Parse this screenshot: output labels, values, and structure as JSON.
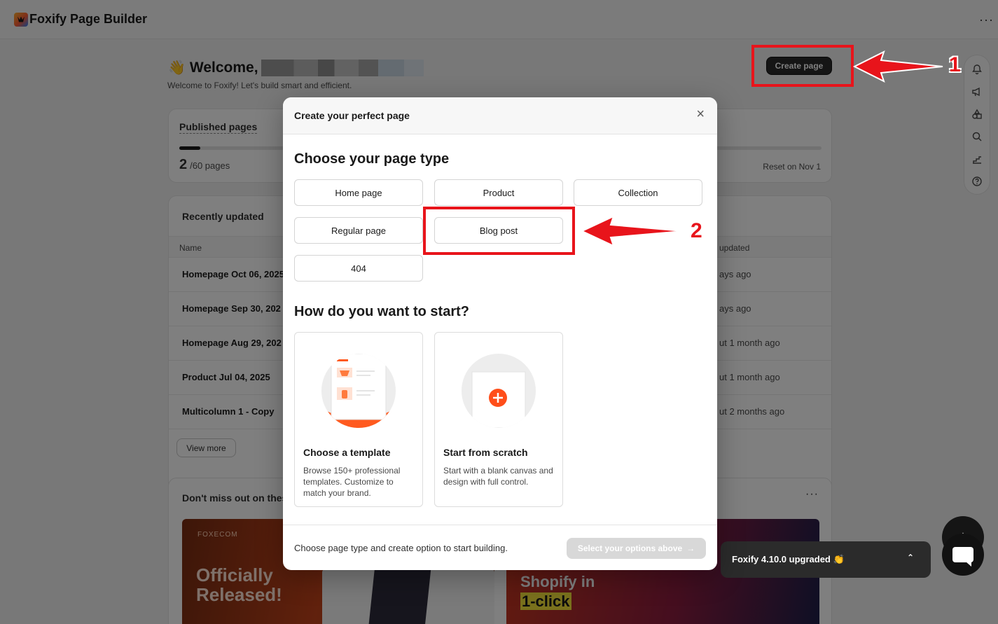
{
  "app": {
    "title": "Foxify Page Builder",
    "more_icon": "more-horizontal-icon"
  },
  "dashboard": {
    "welcome_prefix": "Welcome,",
    "welcome_sub": "Welcome to Foxify! Let's build smart and efficient.",
    "create_page_label": "Create page",
    "published": {
      "title": "Published pages",
      "count": "2",
      "total": "/60 pages",
      "reset": "Reset on Nov 1",
      "progress": 0.033
    },
    "recent": {
      "title": "Recently updated",
      "col_name": "Name",
      "col_updated": "updated",
      "rows": [
        {
          "name": "Homepage Oct 06, 2025",
          "updated": "ays ago"
        },
        {
          "name": "Homepage Sep 30, 202",
          "updated": "ays ago"
        },
        {
          "name": "Homepage Aug 29, 202",
          "updated": "ut 1 month ago"
        },
        {
          "name": "Product Jul 04, 2025",
          "updated": "ut 1 month ago"
        },
        {
          "name": "Multicolumn 1 - Copy",
          "updated": "ut 2 months ago"
        }
      ],
      "view_more": "View more"
    },
    "promo": {
      "title": "Don't miss out on thes",
      "banner1_brand": "FOXECOM",
      "banner1_line1": "Officially",
      "banner1_line2": "Released!",
      "banner2_line1": "Shopify in",
      "banner2_line2": "1-click"
    },
    "toast": "Foxify 4.10.0 upgraded 👏"
  },
  "modal": {
    "title": "Create your perfect page",
    "section1": "Choose your page type",
    "page_types": [
      "Home page",
      "Product",
      "Collection",
      "Regular page",
      "Blog post",
      "404"
    ],
    "section2": "How do you want to start?",
    "options": [
      {
        "title": "Choose a template",
        "desc": "Browse 150+ professional templates. Customize to match your brand."
      },
      {
        "title": "Start from scratch",
        "desc": "Start with a blank canvas and design with full control."
      }
    ],
    "footer_text": "Choose page type and create option to start building.",
    "footer_button": "Select your options above"
  },
  "annotations": {
    "step1": "1",
    "step2": "2",
    "color": "#e8141b"
  }
}
